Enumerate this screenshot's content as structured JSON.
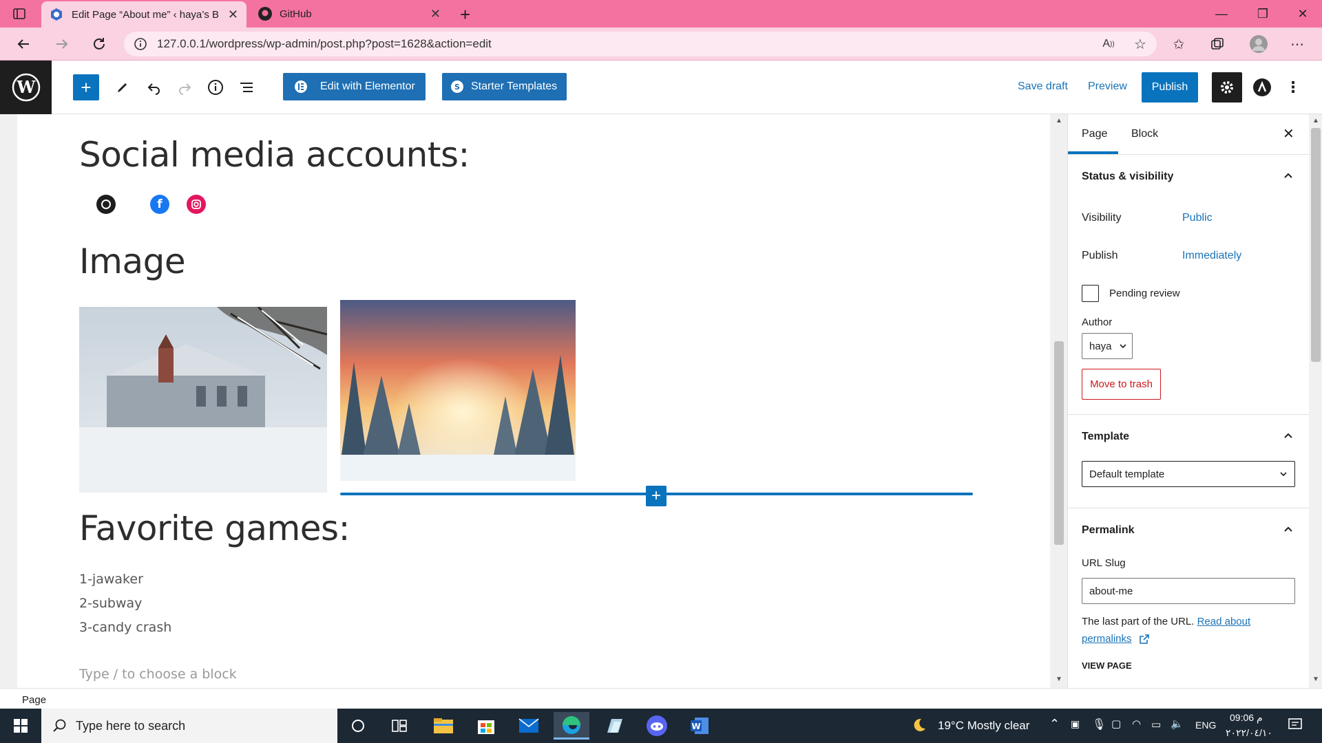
{
  "browser": {
    "tabs": [
      {
        "title": "Edit Page “About me” ‹ haya’s Bl",
        "active": true
      },
      {
        "title": "GitHub",
        "active": false
      }
    ],
    "url": "127.0.0.1/wordpress/wp-admin/post.php?post=1628&action=edit"
  },
  "toolbar": {
    "elementor_label": "Edit with Elementor",
    "starter_label": "Starter Templates",
    "save_draft": "Save draft",
    "preview": "Preview",
    "publish": "Publish"
  },
  "content": {
    "heading_social": "Social media accounts:",
    "heading_image": "Image",
    "heading_games": "Favorite games:",
    "games": [
      "1-jawaker",
      "2-subway",
      "3-candy crash"
    ],
    "placeholder": "Type / to choose a block"
  },
  "sidebar": {
    "tab_page": "Page",
    "tab_block": "Block",
    "status_title": "Status & visibility",
    "visibility_label": "Visibility",
    "visibility_value": "Public",
    "publish_label": "Publish",
    "publish_value": "Immediately",
    "pending_label": "Pending review",
    "author_label": "Author",
    "author_value": "haya",
    "trash_label": "Move to trash",
    "template_title": "Template",
    "template_value": "Default template",
    "permalink_title": "Permalink",
    "slug_label": "URL Slug",
    "slug_value": "about-me",
    "help_text": "The last part of the URL.",
    "read_about": "Read about",
    "permalinks": "permalinks",
    "view_page": "VIEW PAGE"
  },
  "statusbar": {
    "breadcrumb": "Page"
  },
  "taskbar": {
    "search_placeholder": "Type here to search",
    "weather": "19°C  Mostly clear",
    "lang": "ENG",
    "time": "09:06 م",
    "date": "٢٠٢٢/٠٤/١٠"
  },
  "colors": {
    "accent": "#0a73bd",
    "tab_bg": "#f472a0",
    "trash": "#cc1818"
  }
}
